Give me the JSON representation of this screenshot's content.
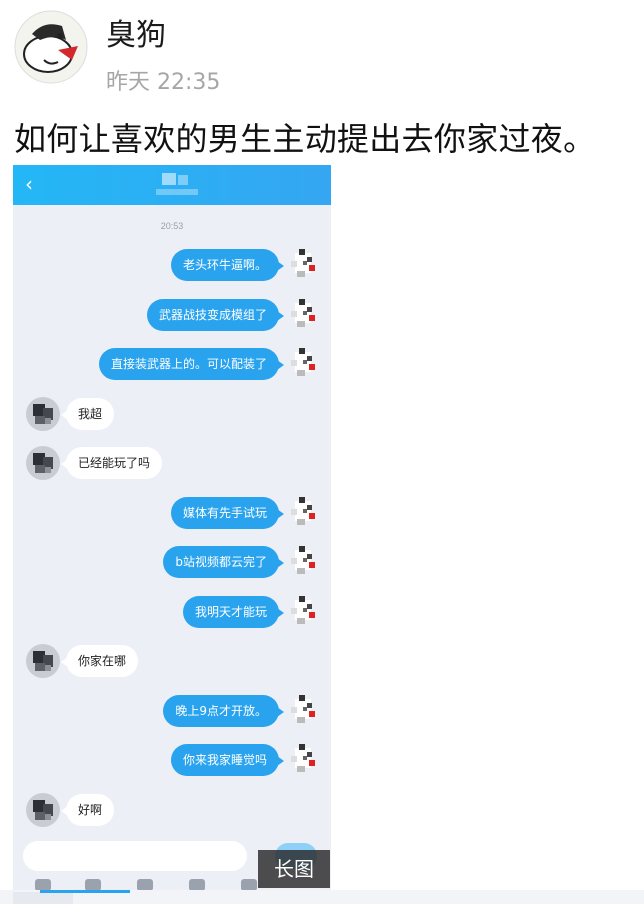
{
  "post": {
    "username": "臭狗",
    "time": "昨天 22:35",
    "text": "如何让喜欢的男生主动提出去你家过夜。"
  },
  "chat": {
    "back_icon": "chevron-left-icon",
    "time_label": "20:53",
    "messages": [
      {
        "side": "right",
        "text": "老头环牛逼啊。"
      },
      {
        "side": "right",
        "text": "武器战技变成模组了"
      },
      {
        "side": "right",
        "text": "直接装武器上的。可以配装了"
      },
      {
        "side": "left",
        "text": "我超"
      },
      {
        "side": "left",
        "text": "已经能玩了吗"
      },
      {
        "side": "right",
        "text": "媒体有先手试玩"
      },
      {
        "side": "right",
        "text": "b站视频都云完了"
      },
      {
        "side": "right",
        "text": "我明天才能玩"
      },
      {
        "side": "left",
        "text": "你家在哪"
      },
      {
        "side": "right",
        "text": "晚上9点才开放。"
      },
      {
        "side": "right",
        "text": "你来我家睡觉吗"
      },
      {
        "side": "left",
        "text": "好啊"
      }
    ],
    "colors": {
      "accent": "#2aa3ef",
      "header": "#23b7f5",
      "background": "#eceff6"
    }
  },
  "badge": {
    "label": "长图"
  }
}
